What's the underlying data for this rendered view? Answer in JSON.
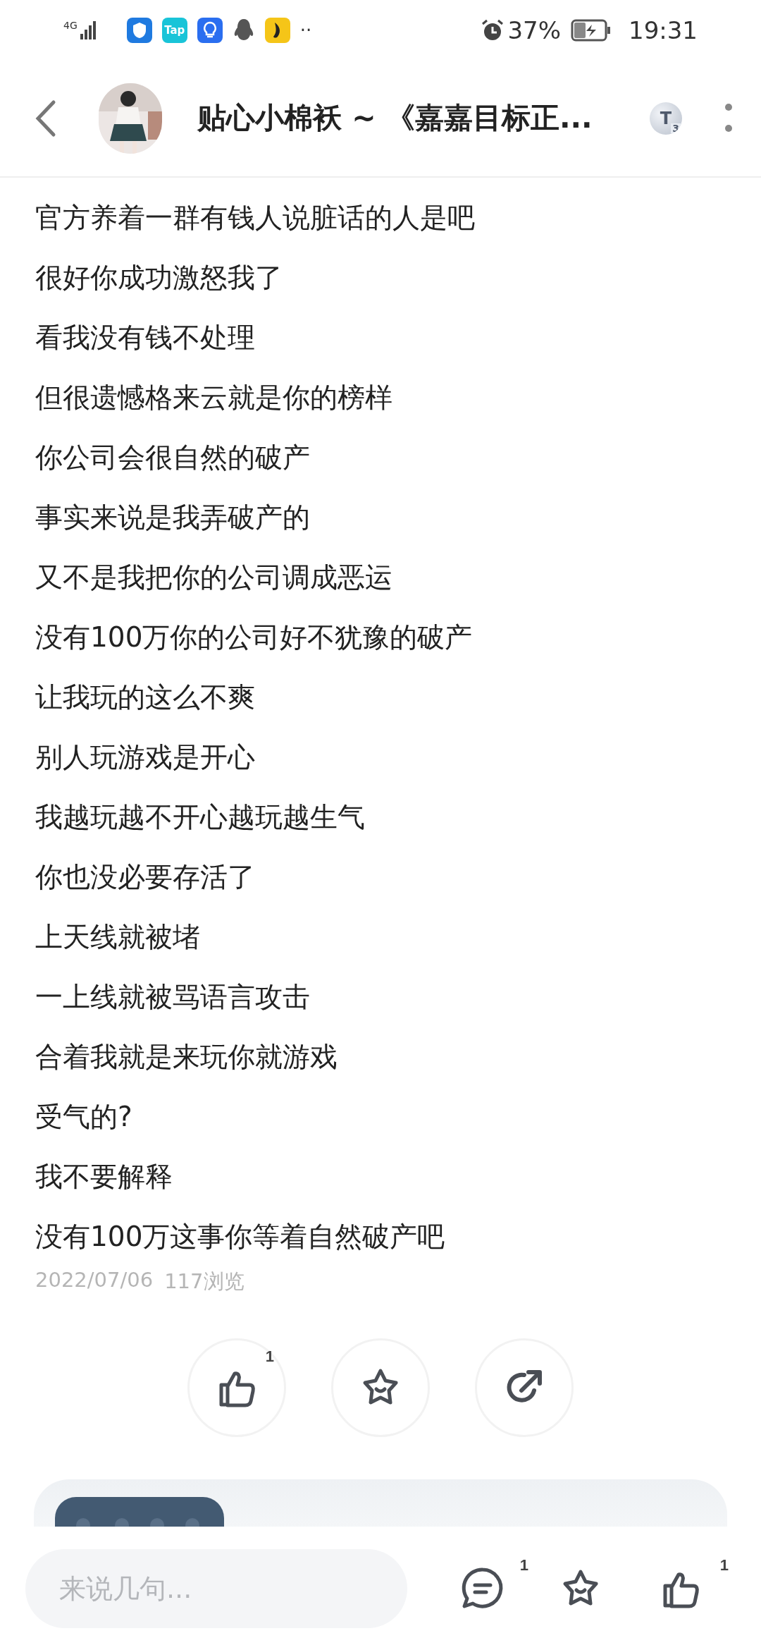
{
  "status_bar": {
    "network": "4G",
    "apps": [
      {
        "kind": "shield"
      },
      {
        "kind": "tap",
        "label": "Tap"
      },
      {
        "kind": "bulb"
      },
      {
        "kind": "penguin"
      },
      {
        "kind": "banana"
      }
    ],
    "more": "··",
    "battery_text": "37%",
    "time": "19:31"
  },
  "header": {
    "title": "贴心小棉袄 ~ 《嘉嘉目标正...",
    "badge": {
      "letter": "T",
      "level": "3"
    }
  },
  "post": {
    "lines": [
      "官方养着一群有钱人说脏话的人是吧",
      "很好你成功激怒我了",
      "看我没有钱不处理",
      "但很遗憾格来云就是你的榜样",
      "你公司会很自然的破产",
      "事实来说是我弄破产的",
      "又不是我把你的公司调成恶运",
      "没有100万你的公司好不犹豫的破产",
      "让我玩的这么不爽",
      "别人玩游戏是开心",
      "我越玩越不开心越玩越生气",
      "你也没必要存活了",
      "上天线就被堵",
      "一上线就被骂语言攻击",
      "合着我就是来玩你就游戏",
      "受气的?",
      "我不要解释",
      "没有100万这事你等着自然破产吧"
    ],
    "date": "2022/07/06",
    "views": "117浏览"
  },
  "actions": [
    {
      "kind": "like",
      "count": "1"
    },
    {
      "kind": "star"
    },
    {
      "kind": "share"
    }
  ],
  "bottom_bar": {
    "placeholder": "来说几句...",
    "buttons": [
      {
        "kind": "comment",
        "count": "1"
      },
      {
        "kind": "star"
      },
      {
        "kind": "like",
        "count": "1"
      }
    ]
  }
}
